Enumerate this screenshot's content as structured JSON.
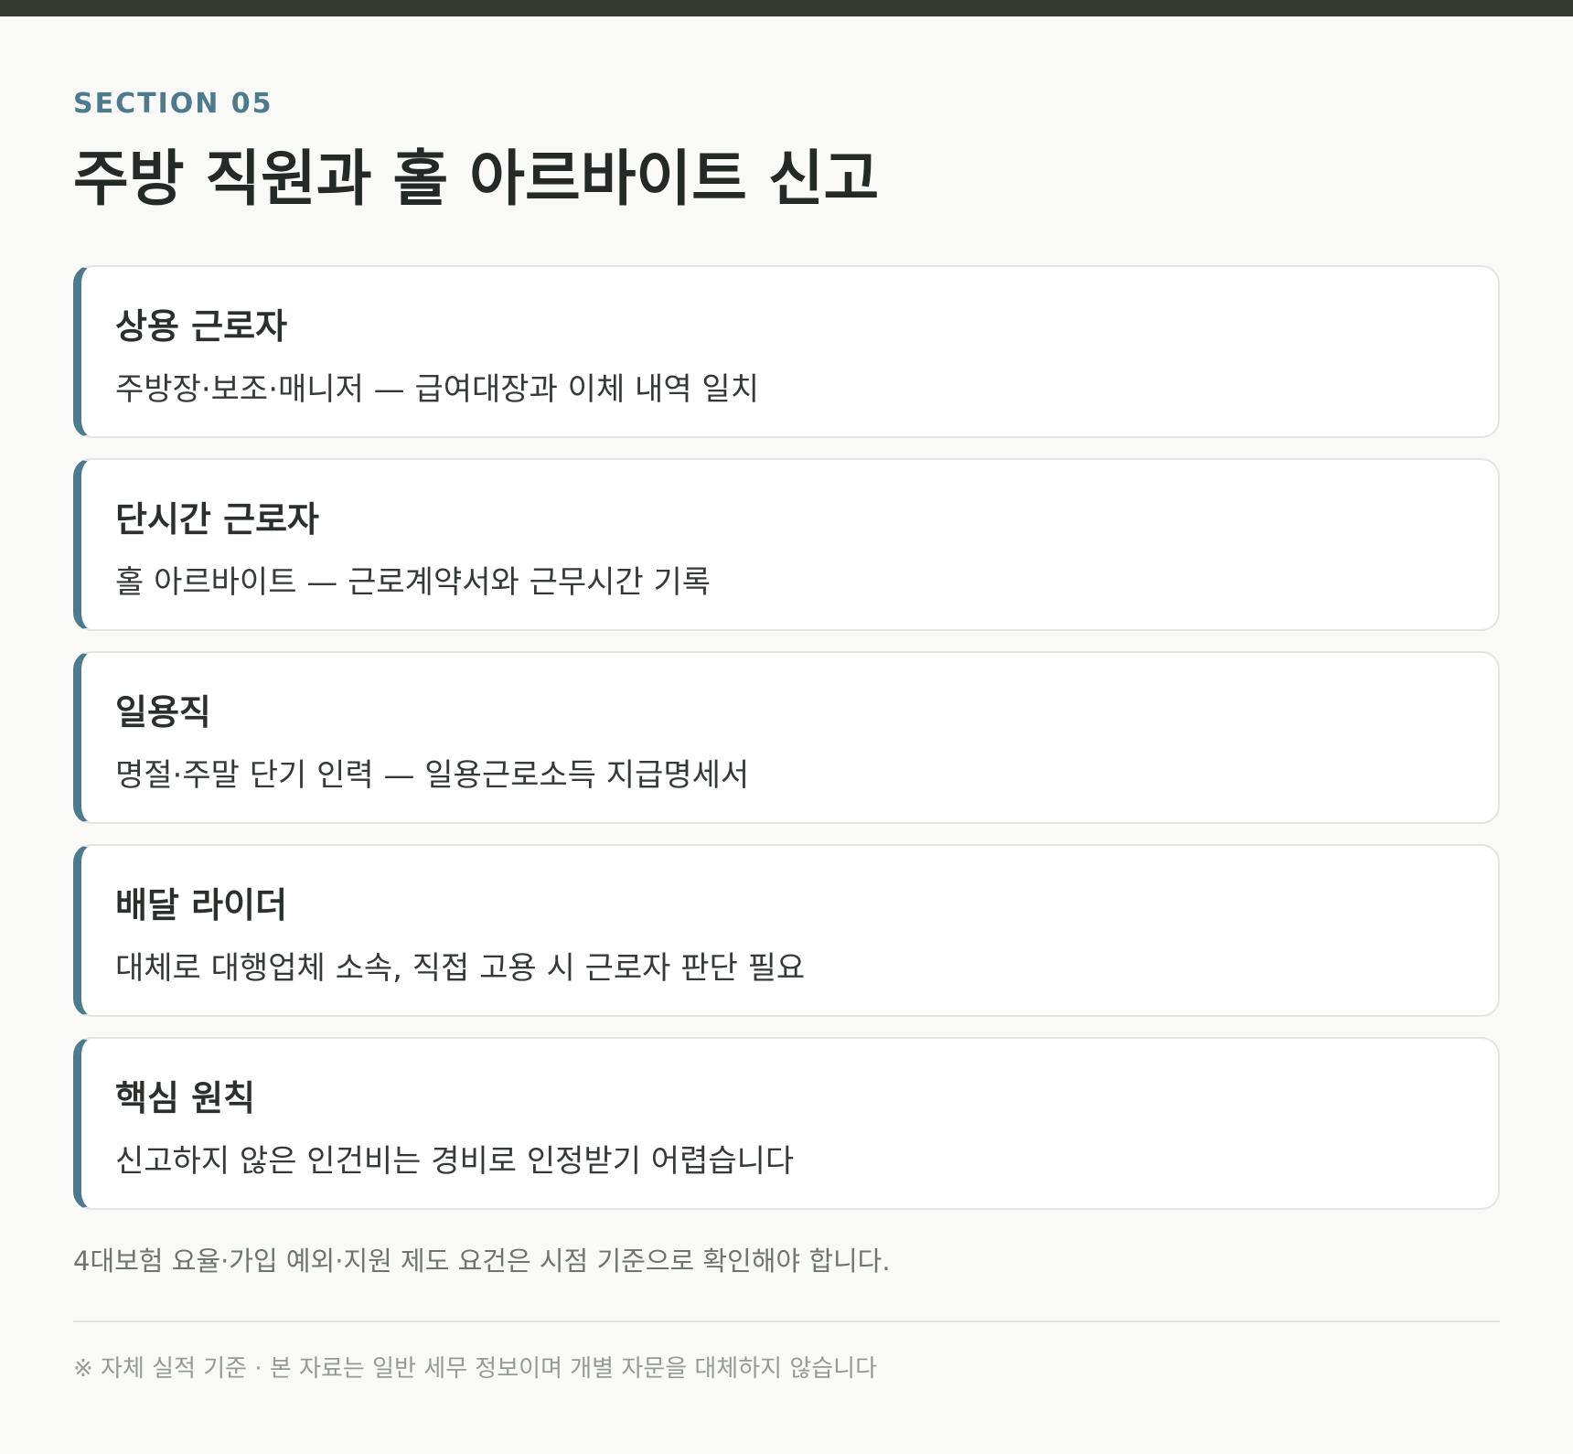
{
  "section_label": "SECTION 05",
  "title": "주방 직원과 홀 아르바이트 신고",
  "cards": [
    {
      "title": "상용 근로자",
      "description": "주방장·보조·매니저 — 급여대장과 이체 내역 일치"
    },
    {
      "title": "단시간 근로자",
      "description": "홀 아르바이트 — 근로계약서와 근무시간 기록"
    },
    {
      "title": "일용직",
      "description": "명절·주말 단기 인력 — 일용근로소득 지급명세서"
    },
    {
      "title": "배달 라이더",
      "description": "대체로 대행업체 소속, 직접 고용 시 근로자 판단 필요"
    },
    {
      "title": "핵심 원칙",
      "description": "신고하지 않은 인건비는 경비로 인정받기 어렵습니다"
    }
  ],
  "note": "4대보험 요율·가입 예외·지원 제도 요건은 시점 기준으로 확인해야 합니다.",
  "footer": "※ 자체 실적 기준 · 본 자료는 일반 세무 정보이며 개별 자문을 대체하지 않습니다",
  "colors": {
    "accent": "#4e7a8e",
    "top_bar": "#333a30",
    "background": "#f9f9f7"
  }
}
